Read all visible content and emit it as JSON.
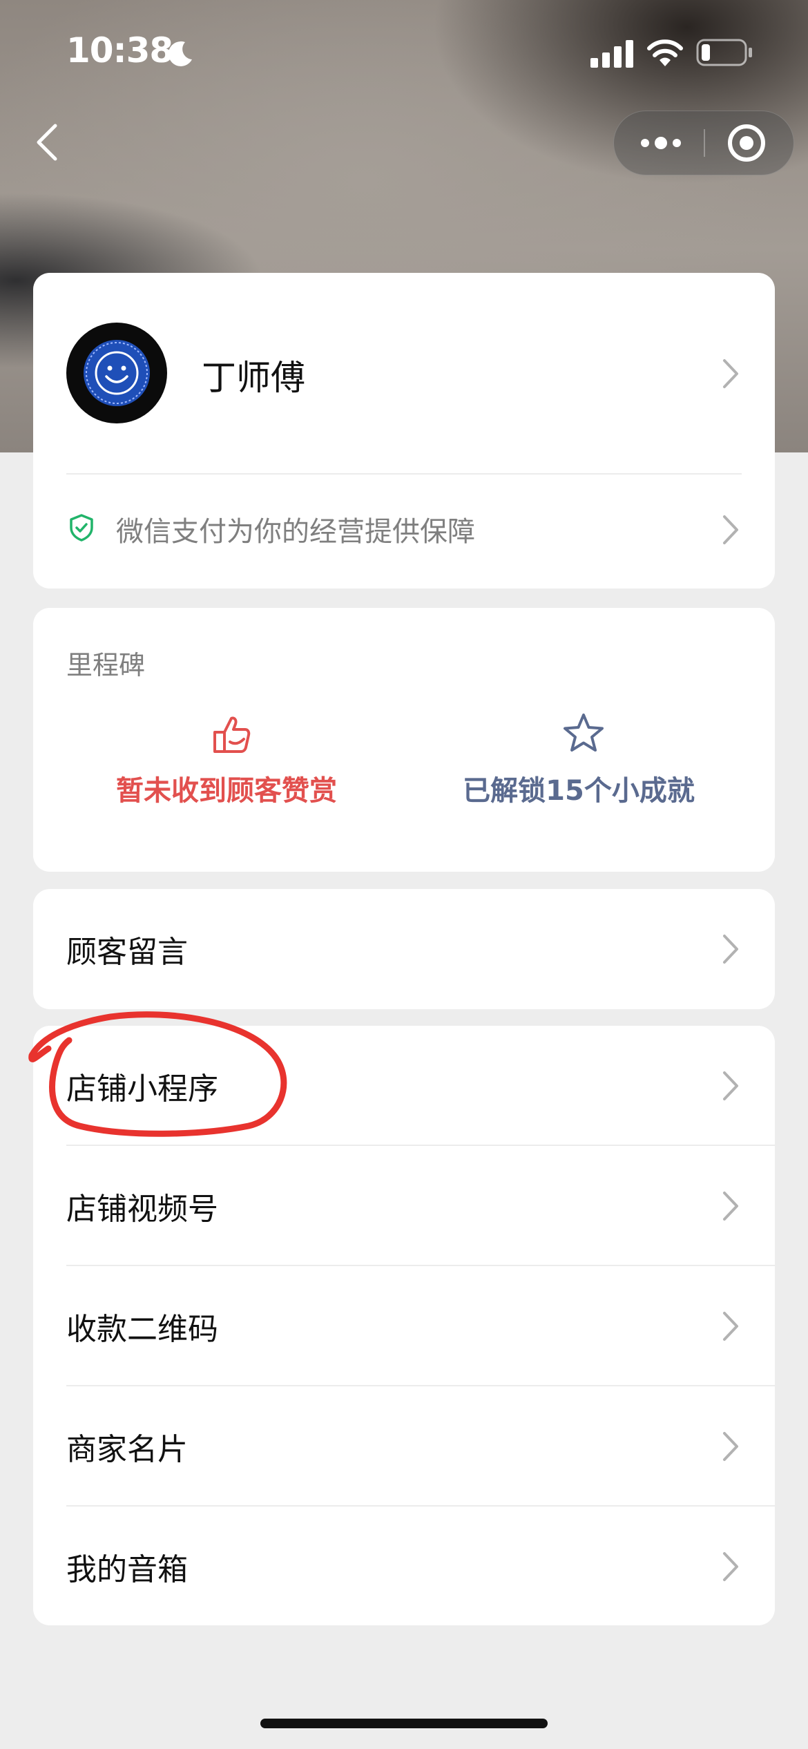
{
  "status_bar": {
    "time": "10:38",
    "icons": [
      "moon-icon",
      "signal-icon",
      "wifi-icon",
      "battery-icon"
    ]
  },
  "nav": {
    "back_icon": "chevron-left-icon",
    "capsule_icons": [
      "more-icon",
      "close-target-icon"
    ]
  },
  "profile": {
    "name": "丁师傅",
    "guarantee_text": "微信支付为你的经营提供保障"
  },
  "milestone": {
    "title": "里程碑",
    "items": [
      {
        "label": "暂未收到顾客赞赏",
        "icon": "thumbs-up-icon",
        "color": "#e2504e"
      },
      {
        "label": "已解锁15个小成就",
        "icon": "star-icon",
        "color": "#5a6a8f"
      }
    ]
  },
  "menu": {
    "group1": [
      {
        "label": "顾客留言"
      }
    ],
    "group2": [
      {
        "label": "店铺小程序"
      },
      {
        "label": "店铺视频号"
      },
      {
        "label": "收款二维码"
      },
      {
        "label": "商家名片"
      },
      {
        "label": "我的音箱"
      }
    ]
  },
  "colors": {
    "background": "#ededed",
    "card": "#ffffff",
    "guarantee_green": "#21b46a",
    "annotation_red": "#e8332e"
  }
}
